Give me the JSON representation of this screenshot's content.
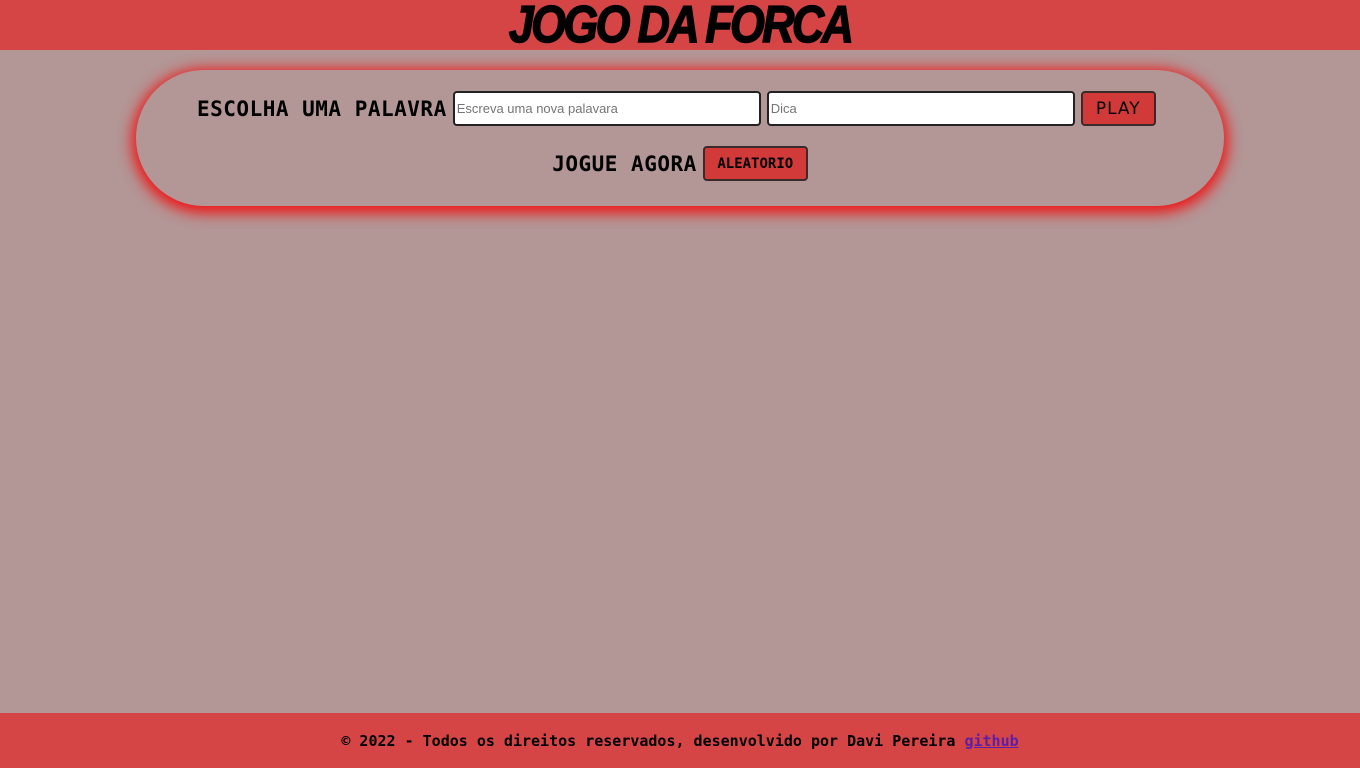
{
  "header": {
    "title": "JOGO DA FORCA"
  },
  "word_form": {
    "choose_label": "ESCOLHA UMA PALAVRA",
    "word_placeholder": "Escreva uma nova palavara",
    "hint_placeholder": "Dica",
    "play_label": "PLAY"
  },
  "random_play": {
    "label": "JOGUE AGORA",
    "button_label": "ALEATORIO"
  },
  "footer": {
    "copyright": "© 2022 - Todos os direitos reservados, desenvolvido por Davi Pereira",
    "link_label": "github"
  },
  "colors": {
    "header_bg": "#d64545",
    "page_bg": "#b39696",
    "button_bg": "#d23a3a",
    "panel_glow": "#f01414",
    "link": "#5b1fa8"
  }
}
